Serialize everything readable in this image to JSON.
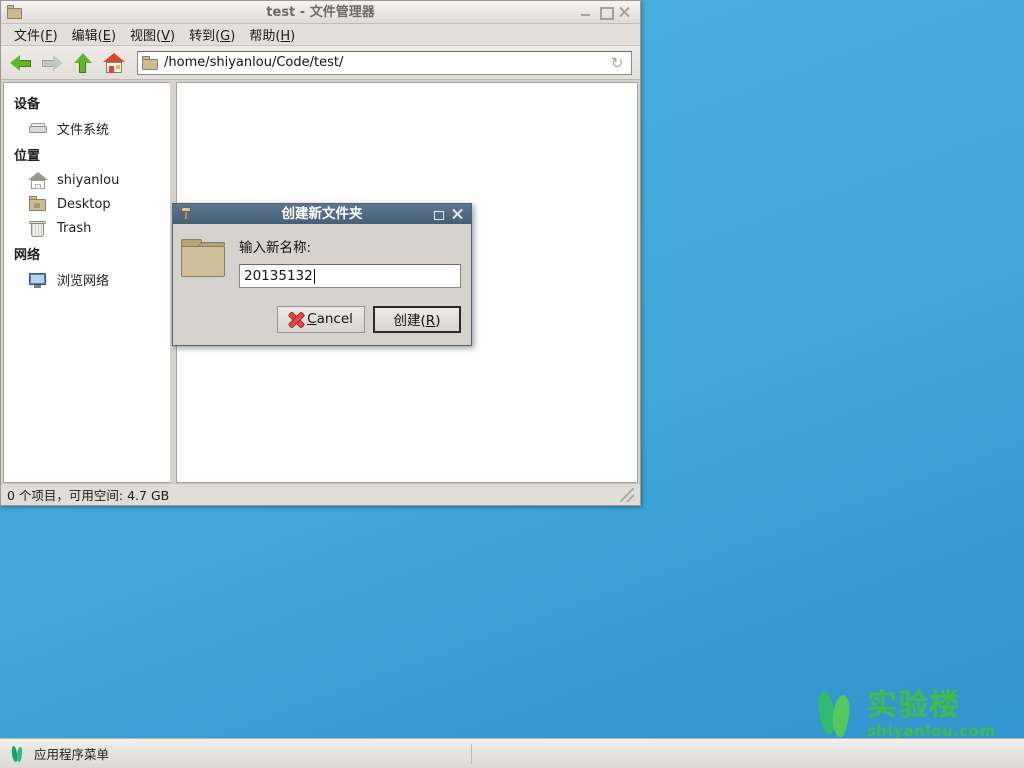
{
  "desktop": {
    "bg_top": "#4fb7e0",
    "bg_bottom": "#2f96cf",
    "watermark": {
      "cn": "实验楼",
      "en": "shiyanlou.com",
      "color": "#3fc23f"
    }
  },
  "taskbar": {
    "app_menu_label": "应用程序菜单",
    "icon": "shiyanlou-leaf-icon"
  },
  "file_manager": {
    "title": "test - 文件管理器",
    "window_buttons": {
      "minimize": "–",
      "maximize": "□",
      "close": "✕"
    },
    "menu": [
      {
        "label": "文件(F)",
        "text": "文件(",
        "accel": "F",
        "tail": ")"
      },
      {
        "label": "编辑(E)",
        "text": "编辑(",
        "accel": "E",
        "tail": ")"
      },
      {
        "label": "视图(V)",
        "text": "视图(",
        "accel": "V",
        "tail": ")"
      },
      {
        "label": "转到(G)",
        "text": "转到(",
        "accel": "G",
        "tail": ")"
      },
      {
        "label": "帮助(H)",
        "text": "帮助(",
        "accel": "H",
        "tail": ")"
      }
    ],
    "toolbar": {
      "back": "back-arrow-icon",
      "forward": "forward-arrow-icon",
      "up": "up-arrow-icon",
      "home": "home-icon",
      "reload": "↻"
    },
    "path": "/home/shiyanlou/Code/test/",
    "sidebar": {
      "sections": [
        {
          "header": "设备",
          "items": [
            {
              "label": "文件系统",
              "icon": "drive-icon"
            }
          ]
        },
        {
          "header": "位置",
          "items": [
            {
              "label": "shiyanlou",
              "icon": "home-icon"
            },
            {
              "label": "Desktop",
              "icon": "folder-icon"
            },
            {
              "label": "Trash",
              "icon": "trash-icon"
            }
          ]
        },
        {
          "header": "网络",
          "items": [
            {
              "label": "浏览网络",
              "icon": "network-icon"
            }
          ]
        }
      ]
    },
    "status": "0 个项目，可用空间: 4.7 GB"
  },
  "dialog": {
    "title": "创建新文件夹",
    "icon": "new-folder-key-icon",
    "window_buttons": {
      "maximize": "□",
      "close": "✕"
    },
    "folder_icon": "folder-icon-large",
    "label": "输入新名称:",
    "input_value": "20135132",
    "input_placeholder": "",
    "buttons": {
      "cancel": {
        "text": "",
        "accel": "C",
        "tail": "ancel",
        "full": "Cancel",
        "icon": "red-x-icon"
      },
      "create": {
        "text": "创建(",
        "accel": "R",
        "tail": ")",
        "full": "创建(R)",
        "default": true
      }
    }
  }
}
